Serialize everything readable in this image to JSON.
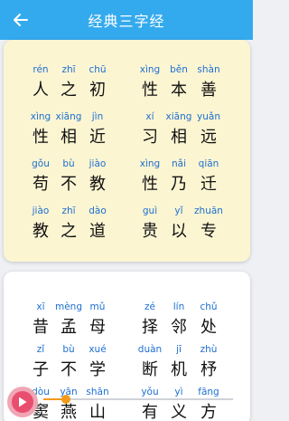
{
  "header": {
    "title": "经典三字经",
    "back_icon": "arrow-left-icon",
    "background": "#34aaee"
  },
  "card1": {
    "background": "#fcf5d2",
    "rows": [
      [
        {
          "py": "rén",
          "hz": "人"
        },
        {
          "py": "zhī",
          "hz": "之"
        },
        {
          "py": "chū",
          "hz": "初"
        },
        {
          "py": "xìng",
          "hz": "性"
        },
        {
          "py": "běn",
          "hz": "本"
        },
        {
          "py": "shàn",
          "hz": "善"
        }
      ],
      [
        {
          "py": "xìng",
          "hz": "性"
        },
        {
          "py": "xiāng",
          "hz": "相"
        },
        {
          "py": "jìn",
          "hz": "近"
        },
        {
          "py": "xí",
          "hz": "习"
        },
        {
          "py": "xiāng",
          "hz": "相"
        },
        {
          "py": "yuǎn",
          "hz": "远"
        }
      ],
      [
        {
          "py": "gǒu",
          "hz": "苟"
        },
        {
          "py": "bù",
          "hz": "不"
        },
        {
          "py": "jiào",
          "hz": "教"
        },
        {
          "py": "xìng",
          "hz": "性"
        },
        {
          "py": "nǎi",
          "hz": "乃"
        },
        {
          "py": "qiān",
          "hz": "迁"
        }
      ],
      [
        {
          "py": "jiào",
          "hz": "教"
        },
        {
          "py": "zhī",
          "hz": "之"
        },
        {
          "py": "dào",
          "hz": "道"
        },
        {
          "py": "guì",
          "hz": "贵"
        },
        {
          "py": "yǐ",
          "hz": "以"
        },
        {
          "py": "zhuān",
          "hz": "专"
        }
      ]
    ]
  },
  "card2": {
    "background": "#ffffff",
    "rows": [
      [
        {
          "py": "xī",
          "hz": "昔"
        },
        {
          "py": "mèng",
          "hz": "孟"
        },
        {
          "py": "mǔ",
          "hz": "母"
        },
        {
          "py": "zé",
          "hz": "择"
        },
        {
          "py": "lín",
          "hz": "邻"
        },
        {
          "py": "chǔ",
          "hz": "处"
        }
      ],
      [
        {
          "py": "zǐ",
          "hz": "子"
        },
        {
          "py": "bù",
          "hz": "不"
        },
        {
          "py": "xué",
          "hz": "学"
        },
        {
          "py": "duàn",
          "hz": "断"
        },
        {
          "py": "jī",
          "hz": "机"
        },
        {
          "py": "zhù",
          "hz": "杼"
        }
      ],
      [
        {
          "py": "dòu",
          "hz": "窦"
        },
        {
          "py": "yān",
          "hz": "燕"
        },
        {
          "py": "shān",
          "hz": "山"
        },
        {
          "py": "yǒu",
          "hz": "有"
        },
        {
          "py": "yì",
          "hz": "义"
        },
        {
          "py": "fāng",
          "hz": "方"
        }
      ]
    ]
  },
  "player": {
    "play_icon": "play-icon",
    "progress": 0.12,
    "accent": "#f39a1a",
    "button_color": "#e94e6e"
  }
}
